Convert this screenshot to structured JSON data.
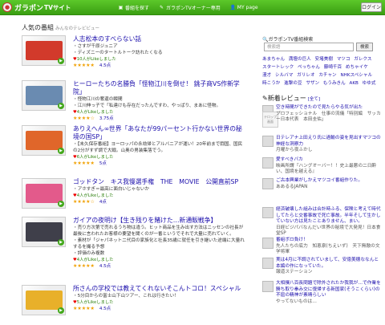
{
  "header": {
    "logo_text": "ガラポン",
    "logo_suffix": "TVサイト",
    "nav": [
      {
        "icon": "tv-icon",
        "glyph": "▣",
        "label": "番組を探す"
      },
      {
        "icon": "message-icon",
        "glyph": "✎",
        "label": "ガラポンTVオーナー専用"
      },
      {
        "icon": "user-icon",
        "glyph": "👤",
        "label": "MY page"
      }
    ],
    "login": "ログイン",
    "accent": "#4fb81f"
  },
  "main": {
    "title": "人気の番組",
    "subtitle": "みんなのテレビビュー",
    "entries": [
      {
        "title": "人志松本のすべらない話",
        "desc": [
          "・さすが千原ジュニア",
          "・ディズニーのタートルトーク訪れたくなる"
        ],
        "likes": "10人がLikeしました",
        "rating": "4.5点",
        "stars": "★★★★★",
        "thumb_color": "#d23a2b"
      },
      {
        "title": "ヒーローたちの名勝負「怪物江川を倒せ！ 銚子商VS作新学院」",
        "desc": [
          "・怪物江川の奪還の瞬間",
          "・江川伸っ子で「私達けも存在だったんですわ、やっぱり、まあに怪物。"
        ],
        "likes": "4人がLikeしました",
        "rating": "3.75点",
        "stars": "★★★★☆",
        "thumb_color": "#6a8bb1"
      },
      {
        "title": "ありえへん∞世界「あなたが99パーセント行かない世界の秘境の国SP」",
        "desc": [
          "・【未久保存番組】ヨーロッパの永劫帰とアルバニアが運い！20年前まで闘国、国民の2分がすず調で大戦。山奥の男装集落でう。"
        ],
        "likes": "6人がLikeしました",
        "rating": "5点",
        "stars": "★★★★★",
        "thumb_color": "#e0662a"
      },
      {
        "title": "ゴッドタン　キス我慢選手権　THE　MOVIE　公開直前SP",
        "desc": [
          "・アホすぎ＝最高に面白いじゃないか"
        ],
        "likes": "4人がLikeしました",
        "rating": "4点",
        "stars": "★★★★☆",
        "thumb_color": "#e35a8b"
      },
      {
        "title": "ガイアの夜明け【生き残りを賭けた…新通販戦争】",
        "desc": [
          "・売り方次第で売れるうち物は違う。ヒット商品を生み出す方法はニッセンの社長が 最後に言われたお客様の要望を聞くのが一番というでそれで大量に売れていく。",
          "・素材が「ジャパネット二代目の家族化と社長35歳に就任を引き継いた途端に大量れ するを撮る予想",
          "・評価のみ複数"
        ],
        "likes": "4人がLikeしました",
        "rating": "4.5点",
        "stars": "★★★★★",
        "thumb_color": "#3f3f4a"
      },
      {
        "title": "所さんの学校では教えてくれないそこんトコロ！スペシャル",
        "desc": [
          "・5分目からの富士山下山ツアー、これは行きたい！"
        ],
        "likes": "5人がLikeしました",
        "rating": "4.5点",
        "stars": "★★★★★",
        "thumb_color": "#e8b02a"
      }
    ]
  },
  "side": {
    "search_title": "ガラポンTV番組検索",
    "search_placeholder": "検索語",
    "search_button": "検索",
    "tags": [
      "あまちゃん",
      "満壇の巨人",
      "安堵美樹",
      "マツコ",
      "ガレクス",
      "スタートレック",
      "ぺっちゃん",
      "藤崎千百",
      "めちゃイケ",
      "漫才",
      "シルバマ",
      "ガリレオ",
      "カチャン",
      "NHKスペシャル",
      "時こうか",
      "進撃の豆",
      "サザン",
      "もうみきん",
      "AKB",
      "ゆゆ式"
    ],
    "rev_title": "新着レビュー",
    "rev_more": "[全て]",
    "reviews": [
      {
        "q": "空き時間ができたので見たらやる気が出た",
        "u": "プロフェッショナル　仕事の流儀「特別編　サッカー日本代表　本田圭佑」",
        "tn": "テロップ画面"
      },
      {
        "q": "日テレアナ上田えり氏に過輸の姿を見出すマツコの神経な洞察力",
        "u": "月曜から夜ふかし"
      },
      {
        "q": "愛すべきバカ",
        "u": "映画所謂『ハングオーバー！！史上最悪の二日酔い、国境を越える』"
      },
      {
        "q": "ご古本興業がしかえマツコイ番組作りた。",
        "u": "ああるるJAPAN"
      },
      {
        "q": "経済破壊した組みは合計時ふる、保険と考えて時代してたらと交番事故で死亡事故。半年そして生かしていない方は見たことありません、まい。",
        "u": "日経ビジパバなんだい世界の秘境で大発見！日本食堂SP"
      },
      {
        "q": "番組ボロ負け！",
        "u": "先人たちの底力　知恵泉(ちえいず)　天下無敵の文学将軍"
      },
      {
        "q": "実は4月に不調されていまして、安徳美穂ななんと本編の作になっていた。",
        "u": "報道ステーション"
      },
      {
        "q": "大相撲八百長問題で除外されたか我我が…で作業を勝ち取り拳み交に復帰する新国家(そうこくらい)の不屈の精神が素晴らしい",
        "u": "やってないものは…"
      }
    ]
  }
}
